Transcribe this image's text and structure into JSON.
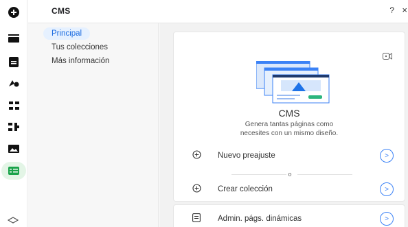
{
  "header": {
    "title": "CMS",
    "help_label": "?",
    "close_label": "×"
  },
  "rail": {
    "icons": [
      "add-icon",
      "sections-icon",
      "pages-icon",
      "design-icon",
      "apps-icon",
      "plugins-icon",
      "media-icon",
      "cms-icon"
    ],
    "active": "cms-icon",
    "accent": "#1aa34a"
  },
  "nav": {
    "items": [
      {
        "label": "Principal",
        "active": true
      },
      {
        "label": "Tus colecciones",
        "active": false
      },
      {
        "label": "Más información",
        "active": false
      }
    ]
  },
  "card": {
    "title": "CMS",
    "description_line1": "Genera tantas páginas como",
    "description_line2": "necesites con un mismo diseño.",
    "actions": [
      {
        "label": "Nuevo preajuste",
        "icon": "plus-circle-icon"
      },
      {
        "label": "Crear colección",
        "icon": "plus-circle-icon"
      }
    ],
    "or_label": "o"
  },
  "card2": {
    "action": {
      "label": "Admin. págs. dinámicas",
      "icon": "page-icon"
    }
  },
  "colors": {
    "link_blue": "#3b82f6",
    "nav_active_bg": "#e6f1ff",
    "nav_active_text": "#1a6be0"
  }
}
